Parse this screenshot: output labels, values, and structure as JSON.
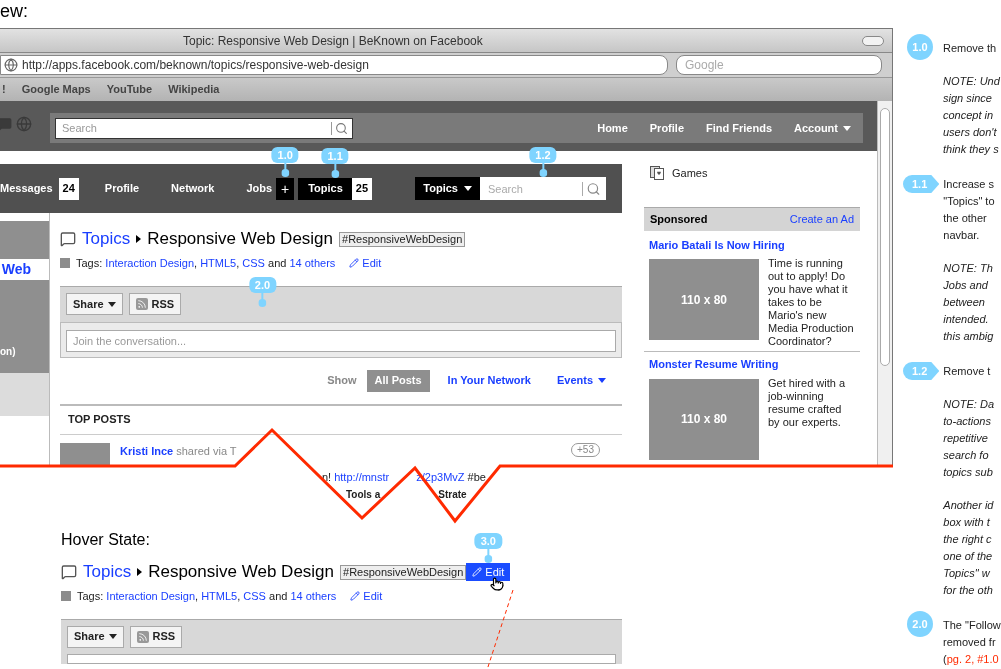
{
  "page_heading": "ew:",
  "browser": {
    "title": "Topic: Responsive Web Design | BeKnown on Facebook",
    "url": "http://apps.facebook.com/beknown/topics/responsive-web-design",
    "search_placeholder": "Google",
    "bookmarks": [
      "!",
      "Google Maps",
      "YouTube",
      "Wikipedia"
    ]
  },
  "facebook_bar": {
    "search_placeholder": "Search",
    "nav": [
      {
        "label": "Home",
        "menu": false
      },
      {
        "label": "Profile",
        "menu": false
      },
      {
        "label": "Find Friends",
        "menu": false
      },
      {
        "label": "Account",
        "menu": true
      }
    ]
  },
  "app_nav": {
    "items": [
      {
        "label": "Messages",
        "count": "24",
        "selected": false
      },
      {
        "label": "Profile",
        "selected": false
      },
      {
        "label": "Network",
        "selected": false
      },
      {
        "label": "Jobs",
        "selected": false
      },
      {
        "label": "Topics",
        "count": "25",
        "selected": true,
        "callout": "1.1"
      }
    ],
    "add_button": {
      "label": "+",
      "callout": "1.0"
    },
    "search": {
      "scope": "Topics",
      "placeholder": "Search",
      "callout": "1.2"
    }
  },
  "left_panel": {
    "title": "Web",
    "note": "on)"
  },
  "topic": {
    "section": "Topics",
    "name": "Responsive Web Design",
    "hashtag": "#ResponsiveWebDesign",
    "tags_label": "Tags:",
    "tags": [
      "Interaction Design",
      "HTML5",
      "CSS"
    ],
    "separator": ",",
    "joiner": "and",
    "others": "14 others",
    "edit": "Edit"
  },
  "share_box": {
    "share": "Share",
    "rss": "RSS",
    "placeholder": "Join the conversation...",
    "callout": "2.0"
  },
  "filter": {
    "label": "Show",
    "options": [
      {
        "label": "All Posts",
        "selected": true,
        "menu": false
      },
      {
        "label": "In Your Network",
        "selected": false,
        "menu": false
      },
      {
        "label": "Events",
        "selected": false,
        "menu": true
      }
    ]
  },
  "top_posts": {
    "title": "TOP POSTS",
    "author": "Kristi Ince",
    "via": "shared via T",
    "count": "+53"
  },
  "post_fragments": {
    "line_1": [
      {
        "kind": "text",
        "text": "n!"
      },
      {
        "kind": "link",
        "text": "http://mnstr"
      },
      {
        "kind": "link",
        "text": "z/2p3MvZ"
      },
      {
        "kind": "text",
        "text": "#be"
      }
    ],
    "line_2": [
      "Tools a",
      "Strate"
    ]
  },
  "sidebar": {
    "games": "Games",
    "sponsored": "Sponsored",
    "create_ad": "Create an Ad",
    "ads": [
      {
        "title": "Mario Batali Is Now Hiring",
        "image": "110 x 80",
        "text": "Time is running out to apply! Do you have what it takes to be Mario's new Media Production Coordinator?"
      },
      {
        "title": "Monster Resume Writing",
        "image": "110 x 80",
        "text": "Get hired with a job-winning resume crafted by our experts."
      }
    ]
  },
  "hover_state": {
    "title": "Hover State:",
    "topic": {
      "section": "Topics",
      "name": "Responsive Web Design",
      "hashtag": "#ResponsiveWebDesign",
      "hashtag_edit": {
        "label": "Edit",
        "hovered": true,
        "callout": "3.0"
      },
      "tags_label": "Tags:",
      "tags": [
        "Interaction Design",
        "HTML5",
        "CSS"
      ],
      "separator": ",",
      "joiner": "and",
      "others": "14 others",
      "edit": "Edit"
    },
    "share": "Share",
    "rss": "RSS"
  },
  "annotations": [
    {
      "kind": "circle",
      "number": "1.0",
      "paragraphs": [
        {
          "kind": "plain",
          "text": "Remove th"
        },
        {
          "kind": "italic",
          "text": "NOTE: Und\nsign since\nconcept in\nusers don't\nthink they s"
        }
      ]
    },
    {
      "kind": "arrow",
      "number": "1.1",
      "paragraphs": [
        {
          "kind": "plain",
          "text": "Increase s\n\"Topics\" to\nthe other\nnavbar."
        },
        {
          "kind": "italic",
          "text": "NOTE: Th\nJobs and\nbetween\nintended.\nthis ambig"
        }
      ]
    },
    {
      "kind": "arrow",
      "number": "1.2",
      "paragraphs": [
        {
          "kind": "plain",
          "text": "Remove t"
        },
        {
          "kind": "italic",
          "text": "NOTE: Da\nto-actions\nrepetitive\nsearch fo\ntopics sub"
        },
        {
          "kind": "italic",
          "text": "Another id\nbox with t\nthe right c\none of the\nTopics\" w\nfor the oth"
        }
      ]
    },
    {
      "kind": "circle",
      "number": "2.0",
      "paragraphs": [
        {
          "kind": "plain",
          "text": "The \"Follow\nremoved fr"
        },
        {
          "kind": "reference",
          "prefix": "(",
          "text": "pg. 2, #1.0"
        }
      ]
    }
  ]
}
